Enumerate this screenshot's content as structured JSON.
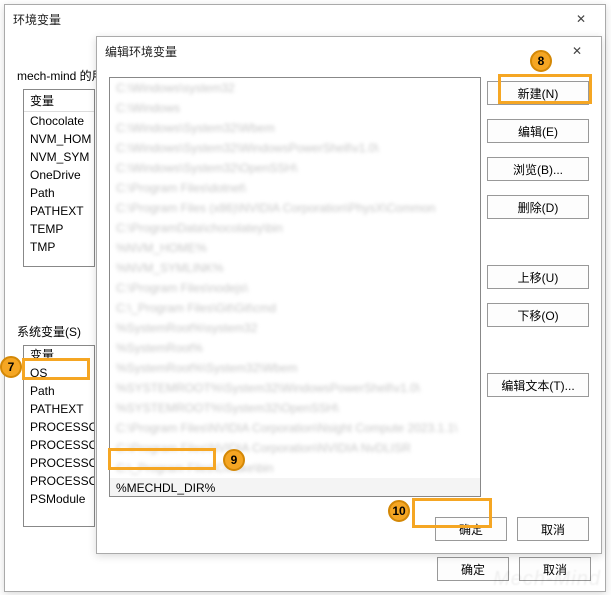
{
  "outer": {
    "title": "环境变量",
    "user_section_label": "mech-mind 的用户变量",
    "sys_section_label": "系统变量(S)",
    "col_header_var": "变量",
    "user_vars": [
      "Chocolate",
      "NVM_HOM",
      "NVM_SYM",
      "OneDrive",
      "Path",
      "PATHEXT",
      "TEMP",
      "TMP"
    ],
    "sys_vars": [
      "变量",
      "OS",
      "Path",
      "PATHEXT",
      "PROCESSO",
      "PROCESSO",
      "PROCESSO",
      "PROCESSO",
      "PSModule"
    ],
    "ok": "确定",
    "cancel": "取消"
  },
  "inner": {
    "title": "编辑环境变量",
    "path_entries_blurred": [
      "C:\\Windows\\system32",
      "C:\\Windows",
      "C:\\Windows\\System32\\Wbem",
      "C:\\Windows\\System32\\WindowsPowerShell\\v1.0\\",
      "C:\\Windows\\System32\\OpenSSH\\",
      "C:\\Program Files\\dotnet\\",
      "C:\\Program Files (x86)\\NVIDIA Corporation\\PhysX\\Common",
      "C:\\ProgramData\\chocolatey\\bin",
      "%NVM_HOME%",
      "%NVM_SYMLINK%",
      "C:\\Program Files\\nodejs\\",
      "C:\\_Program Files\\Git\\Git\\cmd",
      "%SystemRoot%\\system32",
      "%SystemRoot%",
      "%SystemRoot%\\System32\\Wbem",
      "%SYSTEMROOT%\\System32\\WindowsPowerShell\\v1.0\\",
      "%SYSTEMROOT%\\System32\\OpenSSH\\",
      "C:\\Program Files\\NVIDIA Corporation\\Nsight Compute 2023.1.1\\",
      "C:\\Program Files\\NVIDIA Corporation\\NVIDIA NvDLISR",
      "C:\\_Program Files\\CMake\\bin"
    ],
    "last_entry": "%MECHDL_DIR%",
    "buttons": {
      "new": "新建(N)",
      "edit": "编辑(E)",
      "browse": "浏览(B)...",
      "delete": "删除(D)",
      "move_up": "上移(U)",
      "move_down": "下移(O)",
      "edit_text": "编辑文本(T)..."
    },
    "ok": "确定",
    "cancel": "取消"
  },
  "annotations": {
    "m7": "7",
    "m8": "8",
    "m9": "9",
    "m10": "10"
  }
}
